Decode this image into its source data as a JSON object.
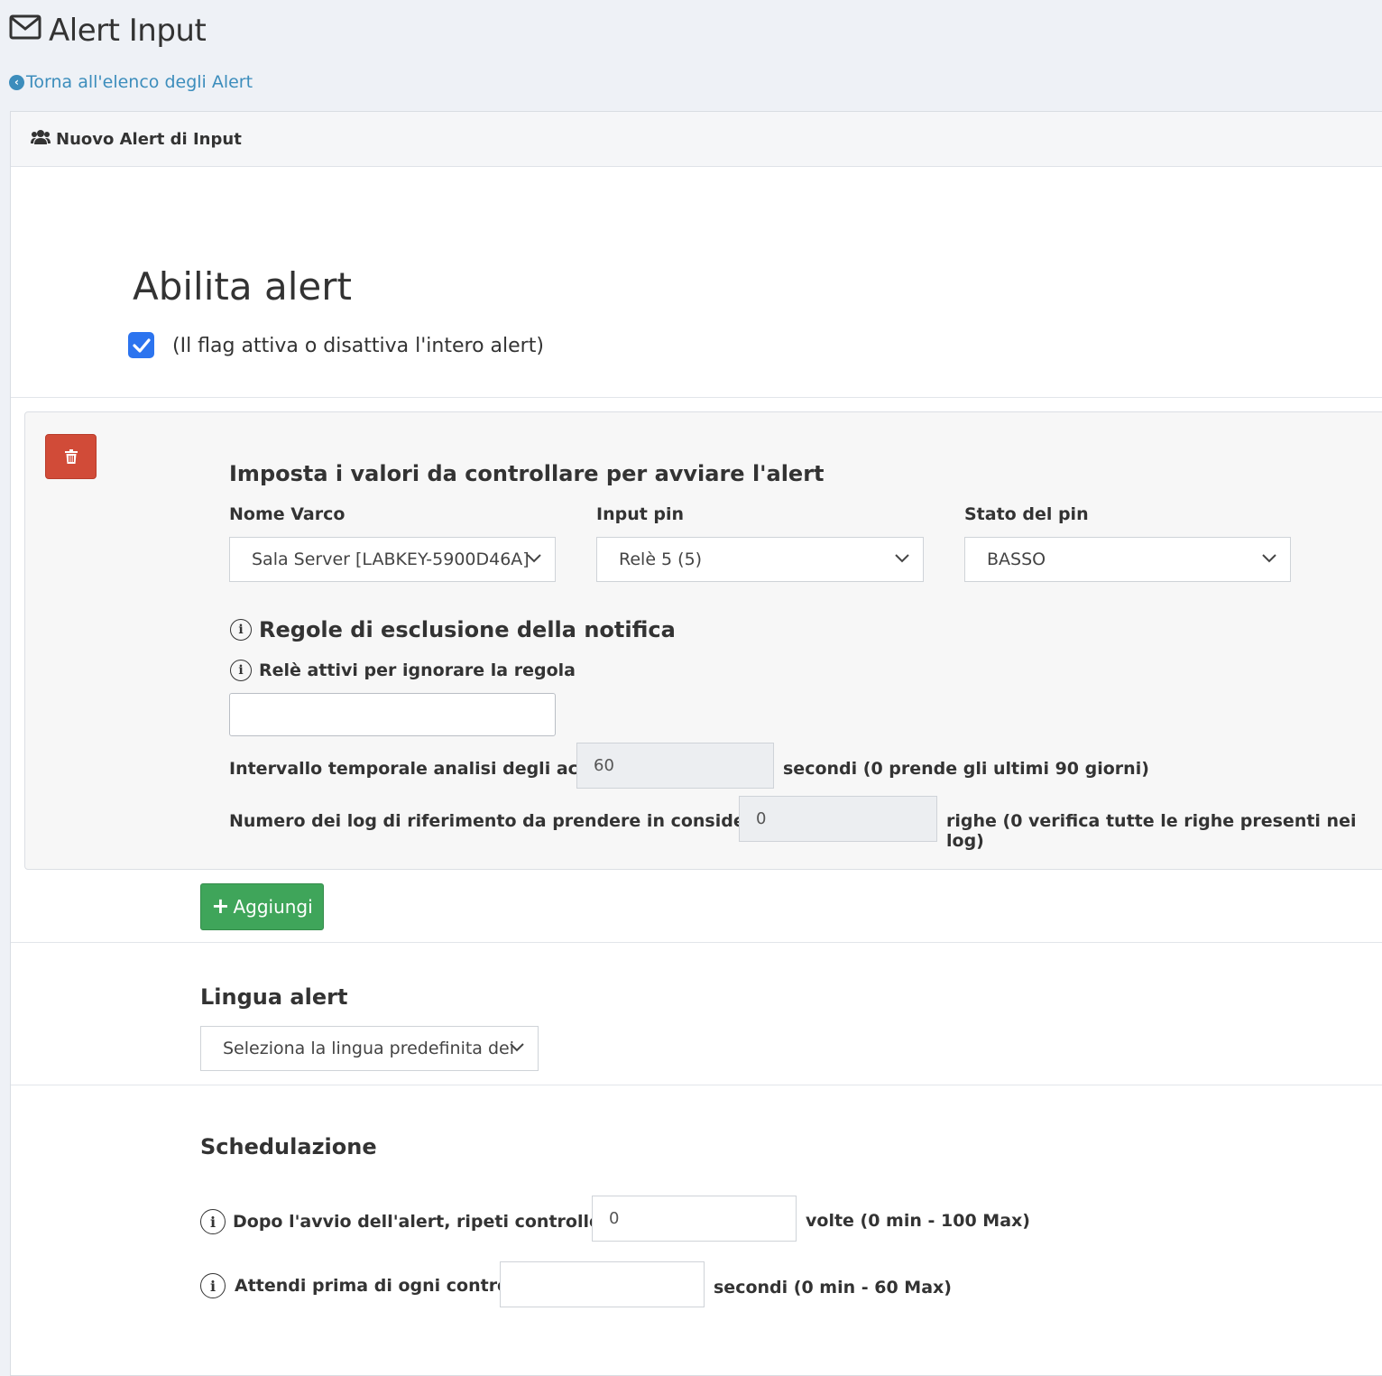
{
  "page": {
    "title": "Alert Input",
    "back_link": "Torna all'elenco degli Alert"
  },
  "box": {
    "header_title": "Nuovo Alert di Input"
  },
  "enable": {
    "heading": "Abilita alert",
    "checked": true,
    "checkbox_label": "(Il flag attiva o disattiva l'intero alert)"
  },
  "rule": {
    "heading": "Imposta i valori da controllare per avviare l'alert",
    "nome_varco_label": "Nome Varco",
    "nome_varco_value": "Sala Server [LABKEY-5900D46A]",
    "input_pin_label": "Input pin",
    "input_pin_value": "Relè 5 (5)",
    "stato_pin_label": "Stato del pin",
    "stato_pin_value": "BASSO",
    "exclusion_heading": "Regole di esclusione della notifica",
    "rele_label": "Relè attivi per ignorare la regola",
    "rele_value": "",
    "interval_label": "Intervallo temporale analisi degli accessi",
    "interval_value": "60",
    "interval_suffix": "secondi (0 prende gli ultimi 90 giorni)",
    "log_label": "Numero dei log di riferimento da prendere in considerazione",
    "log_value": "0",
    "log_suffix": "righe (0 verifica tutte le righe presenti nei log)"
  },
  "add_button": "Aggiungi",
  "language": {
    "heading": "Lingua alert",
    "select_value": "Seleziona la lingua predefinita dei"
  },
  "schedule": {
    "heading": "Schedulazione",
    "repeat_label": "Dopo l'avvio dell'alert, ripeti controllo per",
    "repeat_value": "0",
    "repeat_suffix": "volte (0 min - 100 Max)",
    "wait_label": "Attendi prima di ogni controllo",
    "wait_value": "",
    "wait_suffix": "secondi (0 min - 60 Max)"
  },
  "icons": {
    "title": "envelope-icon",
    "back": "chevron-left-circle-icon",
    "header": "users-icon",
    "delete": "trash-icon",
    "info": "info-icon",
    "add": "plus-icon",
    "select": "chevron-down-icon"
  },
  "colors": {
    "page_bg": "#eef1f6",
    "link": "#3c8dbc",
    "checkbox": "#2c74ef",
    "delete_button": "#d14b38",
    "add_button": "#3fa55a"
  }
}
